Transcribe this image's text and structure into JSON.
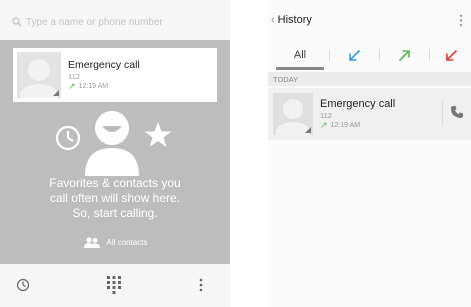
{
  "left": {
    "search": {
      "placeholder": "Type a name or phone number",
      "icon": "search-icon"
    },
    "recent_call": {
      "name": "Emergency call",
      "number": "112",
      "time": "12:19 AM",
      "direction": "outgoing"
    },
    "empty_message": [
      "Favorites & contacts you",
      "call often will show here.",
      "So, start calling."
    ],
    "all_contacts_label": "All contacts",
    "bottom_bar": {
      "icons": [
        "history-clock-icon",
        "dialpad-icon",
        "overflow-menu-icon"
      ]
    }
  },
  "right": {
    "action_bar": {
      "back_icon": "‹",
      "title": "History"
    },
    "tabs": [
      {
        "label": "All",
        "selected": true
      },
      {
        "icon": "incoming-call-icon",
        "color": "#2f9ee8"
      },
      {
        "icon": "outgoing-call-icon",
        "color": "#5cb85c"
      },
      {
        "icon": "missed-call-icon",
        "color": "#e53935"
      }
    ],
    "section_header": "TODAY",
    "call_row": {
      "name": "Emergency call",
      "number": "112",
      "time": "12:19 AM",
      "direction": "outgoing"
    }
  },
  "colors": {
    "incoming": "#2f9ee8",
    "outgoing": "#5cb85c",
    "missed": "#e53935",
    "placeholder_gray": "#bdbdbd"
  }
}
